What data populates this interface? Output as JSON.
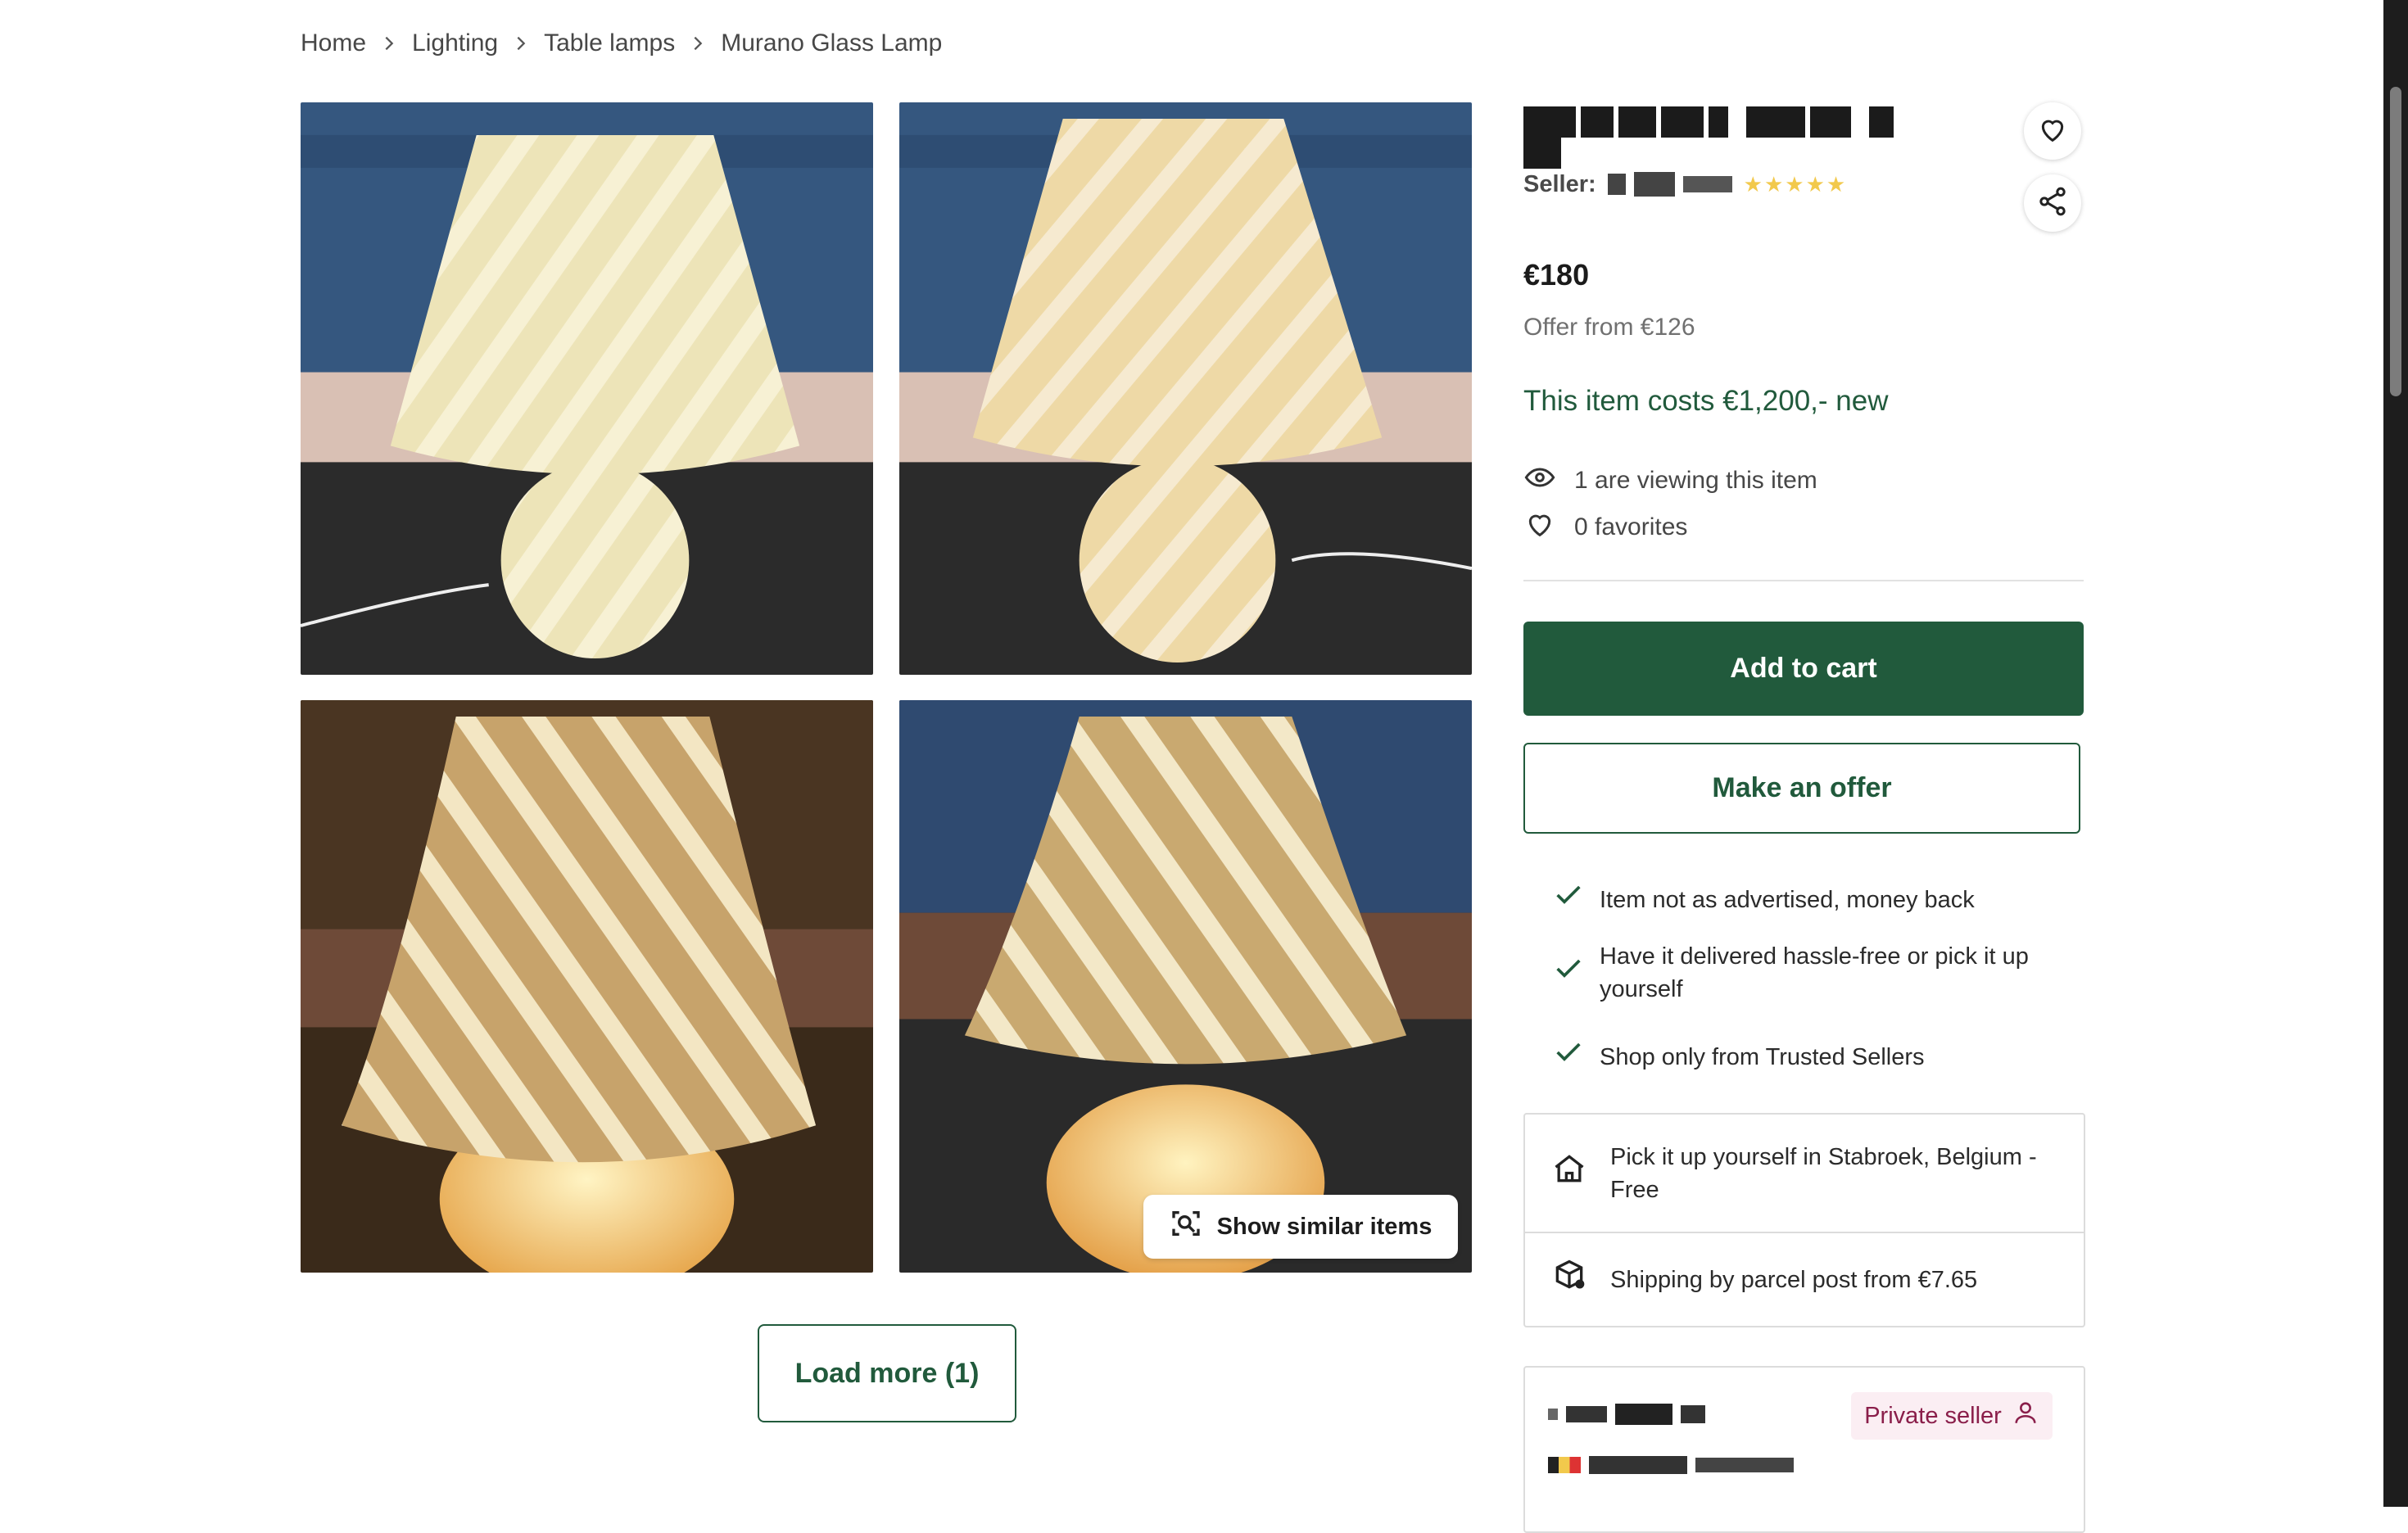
{
  "breadcrumb": {
    "items": [
      "Home",
      "Lighting",
      "Table lamps",
      "Murano Glass Lamp"
    ]
  },
  "gallery": {
    "similar_label": "Show similar items",
    "load_more_label": "Load more (1)"
  },
  "product": {
    "seller_label": "Seller:",
    "rating_stars": 5,
    "price": "€180",
    "offer_from": "Offer from €126",
    "new_cost": "This item costs €1,200,- new",
    "viewing": "1 are viewing this item",
    "favorites": "0 favorites",
    "add_to_cart": "Add to cart",
    "make_offer": "Make an offer",
    "guarantees": [
      "Item not as advertised, money back",
      "Have it delivered hassle-free or pick it up yourself",
      "Shop only from Trusted Sellers"
    ],
    "delivery": {
      "pickup": "Pick it up yourself in Stabroek, Belgium - Free",
      "shipping": "Shipping by parcel post from €7.65"
    },
    "seller_card": {
      "badge": "Private seller"
    }
  },
  "colors": {
    "accent_green": "#215a3c",
    "star_yellow": "#f2c94c",
    "badge_pink": "#fbeef3"
  }
}
